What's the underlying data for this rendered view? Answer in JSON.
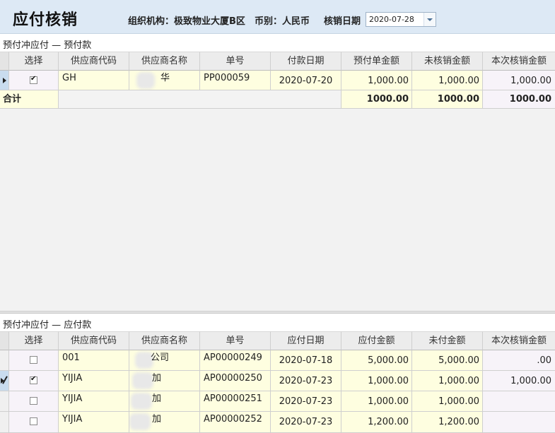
{
  "header": {
    "title": "应付核销",
    "org_label": "组织机构：",
    "org_value": "极致物业大厦B区",
    "currency_label": "币别：",
    "currency_value": "人民币",
    "date_label": "核销日期",
    "date_value": "2020-07-28"
  },
  "prepay": {
    "section_title": "预付冲应付 — 预付款",
    "columns": [
      "选择",
      "供应商代码",
      "供应商名称",
      "单号",
      "付款日期",
      "预付单金额",
      "未核销金额",
      "本次核销金额"
    ],
    "rows": [
      {
        "checked": true,
        "code": "GH",
        "name": "华",
        "no": "PP000059",
        "date": "2020-07-20",
        "amount": "1,000.00",
        "unsettled": "1,000.00",
        "current": "1,000.00"
      }
    ],
    "total_label": "合计",
    "total_amount": "1000.00",
    "total_unsettled": "1000.00",
    "total_current": "1000.00"
  },
  "payable": {
    "section_title": "预付冲应付 — 应付款",
    "columns": [
      "选择",
      "供应商代码",
      "供应商名称",
      "单号",
      "应付日期",
      "应付金额",
      "未付金额",
      "本次核销金额"
    ],
    "rows": [
      {
        "checked": false,
        "code": "001",
        "name": "公司",
        "no": "AP00000249",
        "date": "2020-07-18",
        "amount": "5,000.00",
        "unpaid": "5,000.00",
        "current": ".00"
      },
      {
        "checked": true,
        "code": "YIJIA",
        "name": "加",
        "no": "AP00000250",
        "date": "2020-07-23",
        "amount": "1,000.00",
        "unpaid": "1,000.00",
        "current": "1,000.00"
      },
      {
        "checked": false,
        "code": "YIJIA",
        "name": "加",
        "no": "AP00000251",
        "date": "2020-07-23",
        "amount": "1,000.00",
        "unpaid": "1,000.00",
        "current": ""
      },
      {
        "checked": false,
        "code": "YIJIA",
        "name": "加",
        "no": "AP00000252",
        "date": "2020-07-23",
        "amount": "1,200.00",
        "unpaid": "1,200.00",
        "current": ""
      }
    ]
  }
}
